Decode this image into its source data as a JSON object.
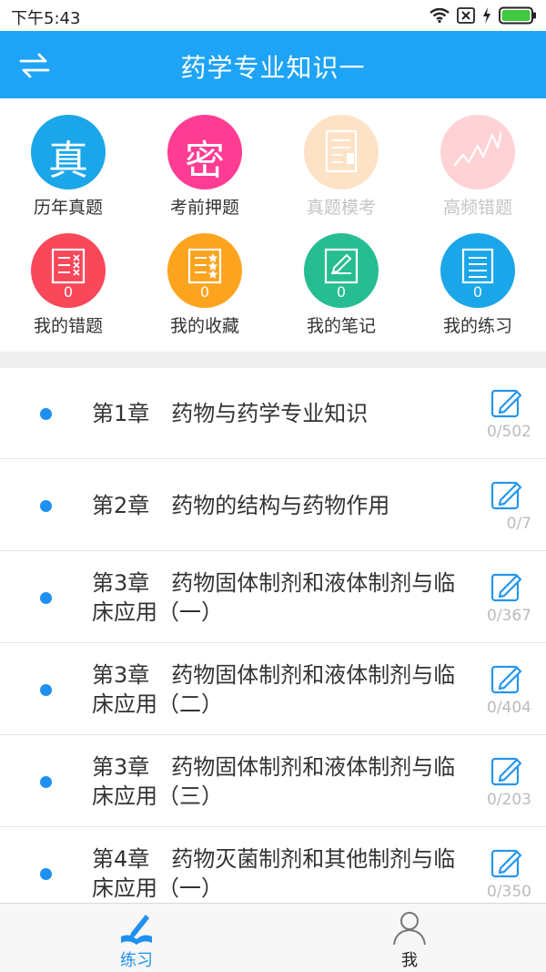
{
  "status_bar": {
    "time": "下午5:43"
  },
  "header": {
    "title": "药学专业知识一"
  },
  "grid": [
    {
      "key": "past",
      "glyph": "真",
      "label": "历年真题",
      "color": "#1aa6e9",
      "dim": false,
      "icon": "zhen-glyph-icon"
    },
    {
      "key": "predict",
      "glyph": "密",
      "label": "考前押题",
      "color": "#ff3c94",
      "dim": false,
      "icon": "mi-glyph-icon"
    },
    {
      "key": "mock",
      "label": "真题模考",
      "color": "#fde2c6",
      "dim": true,
      "icon": "exam-paper-icon"
    },
    {
      "key": "freq",
      "label": "高频错题",
      "color": "#ffd2d6",
      "dim": true,
      "icon": "trend-line-icon"
    },
    {
      "key": "wrong",
      "label": "我的错题",
      "count": "0",
      "color": "#f8485a",
      "dim": false,
      "icon": "wrong-list-icon"
    },
    {
      "key": "fav",
      "label": "我的收藏",
      "count": "0",
      "color": "#fda41f",
      "dim": false,
      "icon": "star-list-icon"
    },
    {
      "key": "notes",
      "label": "我的笔记",
      "count": "0",
      "color": "#27bd92",
      "dim": false,
      "icon": "note-pen-icon"
    },
    {
      "key": "practice",
      "label": "我的练习",
      "count": "0",
      "color": "#1aa6e9",
      "dim": false,
      "icon": "practice-book-icon"
    }
  ],
  "chapters": [
    {
      "title": "第1章　药物与药学专业知识",
      "progress": "0/502"
    },
    {
      "title": "第2章　药物的结构与药物作用",
      "progress": "0/7"
    },
    {
      "title": "第3章　药物固体制剂和液体制剂与临床应用（一）",
      "progress": "0/367"
    },
    {
      "title": "第3章　药物固体制剂和液体制剂与临床应用（二）",
      "progress": "0/404"
    },
    {
      "title": "第3章　药物固体制剂和液体制剂与临床应用（三）",
      "progress": "0/203"
    },
    {
      "title": "第4章　药物灭菌制剂和其他制剂与临床应用（一）",
      "progress": "0/350"
    }
  ],
  "tabs": [
    {
      "label": "练习",
      "active": true
    },
    {
      "label": "我",
      "active": false
    }
  ],
  "colors": {
    "primary": "#1ea4f6",
    "accent": "#1e90f0"
  }
}
